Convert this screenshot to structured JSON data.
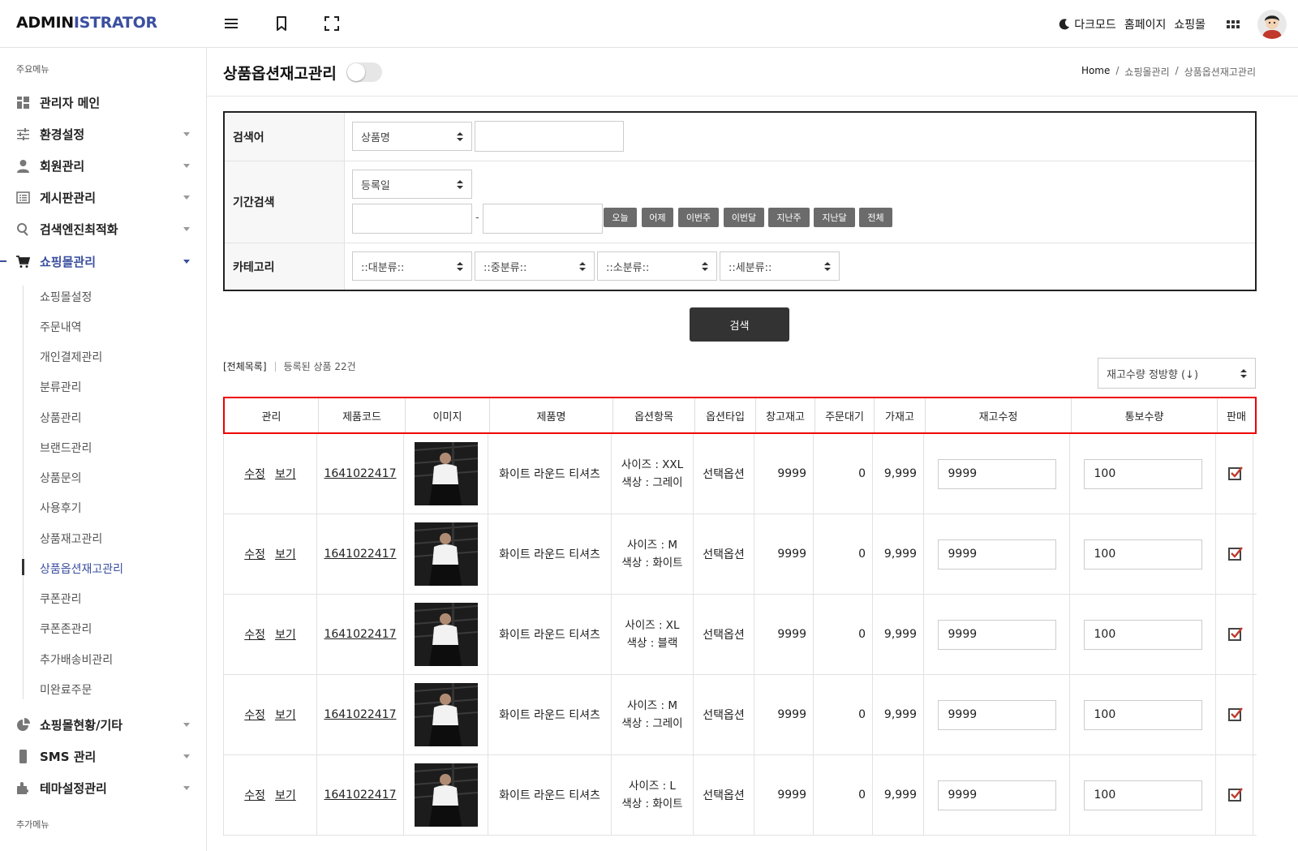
{
  "header": {
    "logo_part1": "ADMIN",
    "logo_part2": "ISTRATOR",
    "links": [
      "다크모드",
      "홈페이지",
      "쇼핑몰"
    ]
  },
  "sidebar": {
    "main_caption": "주요메뉴",
    "menu": [
      {
        "label": "관리자 메인",
        "icon": "dashboard-icon"
      },
      {
        "label": "환경설정",
        "icon": "sliders-icon"
      },
      {
        "label": "회원관리",
        "icon": "user-icon"
      },
      {
        "label": "게시판관리",
        "icon": "list-icon"
      },
      {
        "label": "검색엔진최적화",
        "icon": "search-icon"
      },
      {
        "label": "쇼핑몰관리",
        "icon": "cart-icon"
      }
    ],
    "submenu": [
      "쇼핑몰설정",
      "주문내역",
      "개인결제관리",
      "분류관리",
      "상품관리",
      "브랜드관리",
      "상품문의",
      "사용후기",
      "상품재고관리",
      "상품옵션재고관리",
      "쿠폰관리",
      "쿠폰존관리",
      "추가배송비관리",
      "미완료주문"
    ],
    "menu2": [
      {
        "label": "쇼핑몰현황/기타",
        "icon": "pie-chart-icon"
      },
      {
        "label": "SMS 관리",
        "icon": "phone-icon"
      },
      {
        "label": "테마설정관리",
        "icon": "puzzle-icon"
      }
    ],
    "extra_caption": "추가메뉴"
  },
  "page": {
    "title": "상품옵션재고관리",
    "breadcrumb": [
      "Home",
      "/",
      "쇼핑몰관리",
      "/",
      "상품옵션재고관리"
    ]
  },
  "search": {
    "keyword_label": "검색어",
    "keyword_select": "상품명",
    "keyword_value": "",
    "period_label": "기간검색",
    "period_select": "등록일",
    "date_dash": "-",
    "quick_buttons": [
      "오늘",
      "어제",
      "이번주",
      "이번달",
      "지난주",
      "지난달",
      "전체"
    ],
    "category_label": "카테고리",
    "categories": [
      "::대분류::",
      "::중분류::",
      "::소분류::",
      "::세분류::"
    ],
    "submit": "검색"
  },
  "list": {
    "all_label": "[전체목록]",
    "count_text": "등록된 상품 22건",
    "sort": "재고수량 정방향 (↓)"
  },
  "table": {
    "headers": [
      "관리",
      "제품코드",
      "이미지",
      "제품명",
      "옵션항목",
      "옵션타입",
      "창고재고",
      "주문대기",
      "가재고",
      "재고수정",
      "통보수량",
      "판매"
    ],
    "rows": [
      {
        "edit": "수정",
        "view": "보기",
        "code": "1641022417",
        "name": "화이트 라운드 티셔츠",
        "opt1": "사이즈 : XXL",
        "opt2": "색상 : 그레이",
        "type": "선택옵션",
        "stock": "9999",
        "pending": "0",
        "temp": "9,999",
        "qty": "9999",
        "notify": "100"
      },
      {
        "edit": "수정",
        "view": "보기",
        "code": "1641022417",
        "name": "화이트 라운드 티셔츠",
        "opt1": "사이즈 : M",
        "opt2": "색상 : 화이트",
        "type": "선택옵션",
        "stock": "9999",
        "pending": "0",
        "temp": "9,999",
        "qty": "9999",
        "notify": "100"
      },
      {
        "edit": "수정",
        "view": "보기",
        "code": "1641022417",
        "name": "화이트 라운드 티셔츠",
        "opt1": "사이즈 : XL",
        "opt2": "색상 : 블랙",
        "type": "선택옵션",
        "stock": "9999",
        "pending": "0",
        "temp": "9,999",
        "qty": "9999",
        "notify": "100"
      },
      {
        "edit": "수정",
        "view": "보기",
        "code": "1641022417",
        "name": "화이트 라운드 티셔츠",
        "opt1": "사이즈 : M",
        "opt2": "색상 : 그레이",
        "type": "선택옵션",
        "stock": "9999",
        "pending": "0",
        "temp": "9,999",
        "qty": "9999",
        "notify": "100"
      },
      {
        "edit": "수정",
        "view": "보기",
        "code": "1641022417",
        "name": "화이트 라운드 티셔츠",
        "opt1": "사이즈 : L",
        "opt2": "색상 : 화이트",
        "type": "선택옵션",
        "stock": "9999",
        "pending": "0",
        "temp": "9,999",
        "qty": "9999",
        "notify": "100"
      }
    ]
  },
  "colors": {
    "accent": "#3b4fa0",
    "highlight": "#e00000",
    "check": "#c0392b"
  }
}
